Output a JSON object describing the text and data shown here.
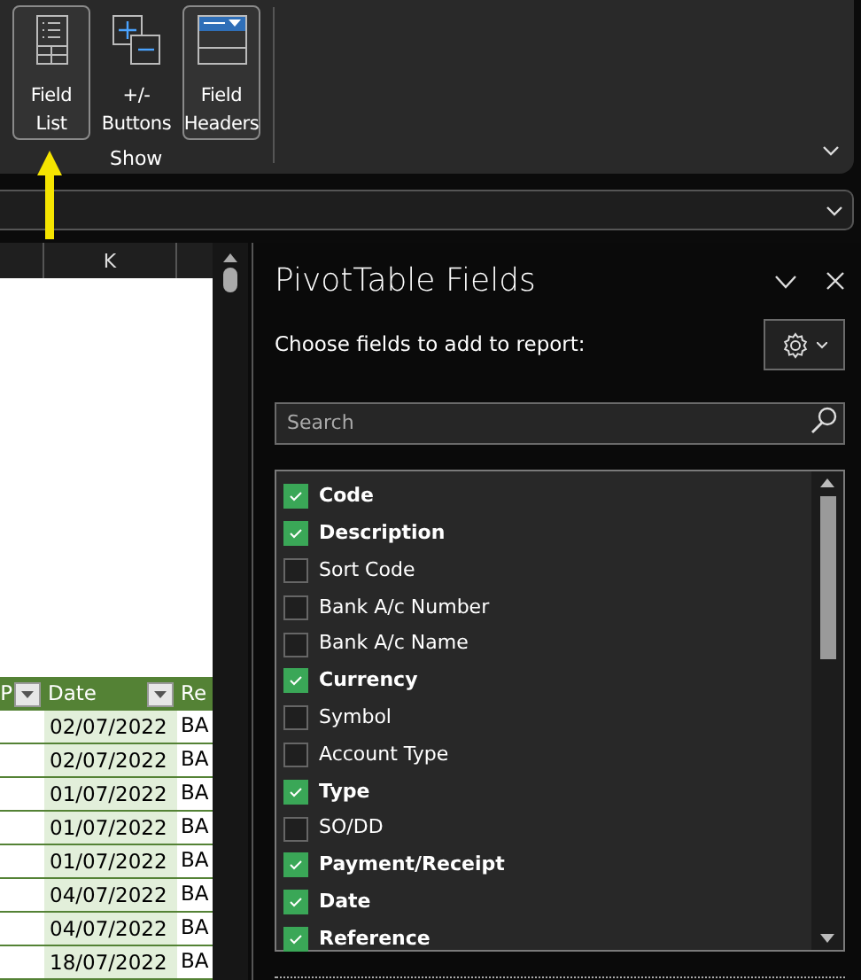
{
  "ribbon": {
    "buttons": [
      {
        "label": "Field List",
        "selected": true
      },
      {
        "label": "+/- Buttons",
        "selected": false
      },
      {
        "label": "Field Headers",
        "selected": true
      }
    ],
    "group_label": "Show"
  },
  "sheet": {
    "column_header": "K",
    "table": {
      "columns": [
        "P",
        "Date",
        "Re"
      ],
      "rows": [
        {
          "date": "02/07/2022",
          "column_3": "BA"
        },
        {
          "date": "02/07/2022",
          "column_3": "BA"
        },
        {
          "date": "01/07/2022",
          "column_3": "BA"
        },
        {
          "date": "01/07/2022",
          "column_3": "BA"
        },
        {
          "date": "01/07/2022",
          "column_3": "BA"
        },
        {
          "date": "04/07/2022",
          "column_3": "BA"
        },
        {
          "date": "04/07/2022",
          "column_3": "BA"
        },
        {
          "date": "18/07/2022",
          "column_3": "BA"
        }
      ]
    }
  },
  "panel": {
    "title": "PivotTable Fields",
    "subtitle": "Choose fields to add to report:",
    "search": {
      "placeholder": "Search"
    },
    "fields": [
      {
        "label": "Code",
        "checked": true
      },
      {
        "label": "Description",
        "checked": true
      },
      {
        "label": "Sort Code",
        "checked": false
      },
      {
        "label": "Bank A/c Number",
        "checked": false
      },
      {
        "label": "Bank A/c Name",
        "checked": false
      },
      {
        "label": "Currency",
        "checked": true
      },
      {
        "label": "Symbol",
        "checked": false
      },
      {
        "label": "Account Type",
        "checked": false
      },
      {
        "label": "Type",
        "checked": true
      },
      {
        "label": "SO/DD",
        "checked": false
      },
      {
        "label": "Payment/Receipt",
        "checked": true
      },
      {
        "label": "Date",
        "checked": true
      },
      {
        "label": "Reference",
        "checked": true
      }
    ]
  }
}
